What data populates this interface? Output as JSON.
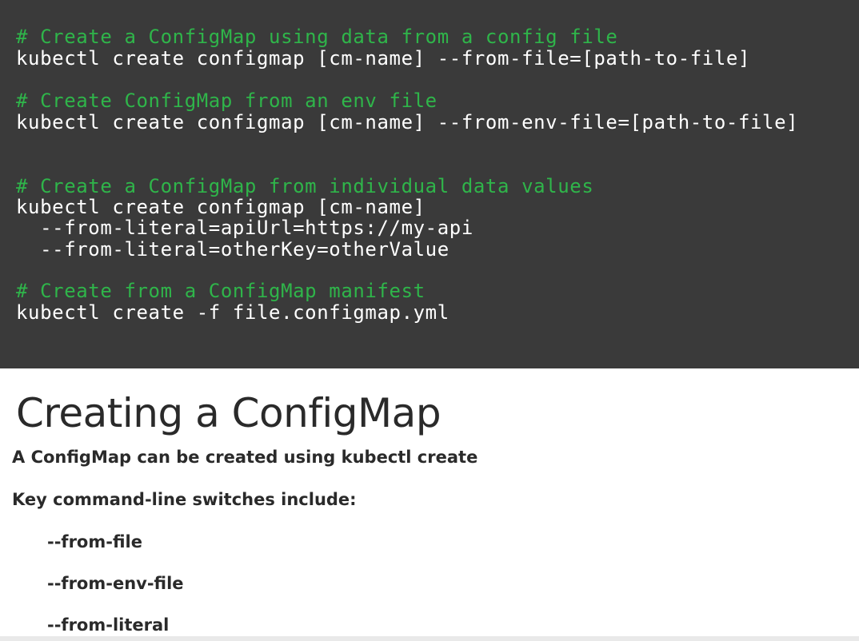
{
  "code_block": {
    "lines": [
      {
        "kind": "comment",
        "text": "# Create a ConfigMap using data from a config file"
      },
      {
        "kind": "cmd",
        "text": "kubectl create configmap [cm-name] --from-file=[path-to-file]"
      },
      {
        "kind": "comment",
        "text": "# Create ConfigMap from an env file"
      },
      {
        "kind": "cmd",
        "text": "kubectl create configmap [cm-name] --from-env-file=[path-to-file]"
      },
      {
        "kind": "comment",
        "text": "# Create a ConfigMap from individual data values"
      },
      {
        "kind": "cmd",
        "text": "kubectl create configmap [cm-name]"
      },
      {
        "kind": "cmd",
        "text": "  --from-literal=apiUrl=https://my-api"
      },
      {
        "kind": "cmd",
        "text": "  --from-literal=otherKey=otherValue"
      },
      {
        "kind": "comment",
        "text": "# Create from a ConfigMap manifest"
      },
      {
        "kind": "cmd",
        "text": "kubectl create -f file.configmap.yml"
      }
    ]
  },
  "slide": {
    "title": "Creating a ConfigMap",
    "intro_prefix": "A ConfigMap can be created using ",
    "intro_command": "kubectl create",
    "switches_heading": "Key command-line switches include:",
    "switches": [
      "--from-file",
      "--from-env-file",
      "--from-literal"
    ]
  },
  "colors": {
    "code_background": "#3a3a3a",
    "comment": "#2fb54a",
    "command": "#ffffff",
    "text": "#2a2a2a"
  }
}
